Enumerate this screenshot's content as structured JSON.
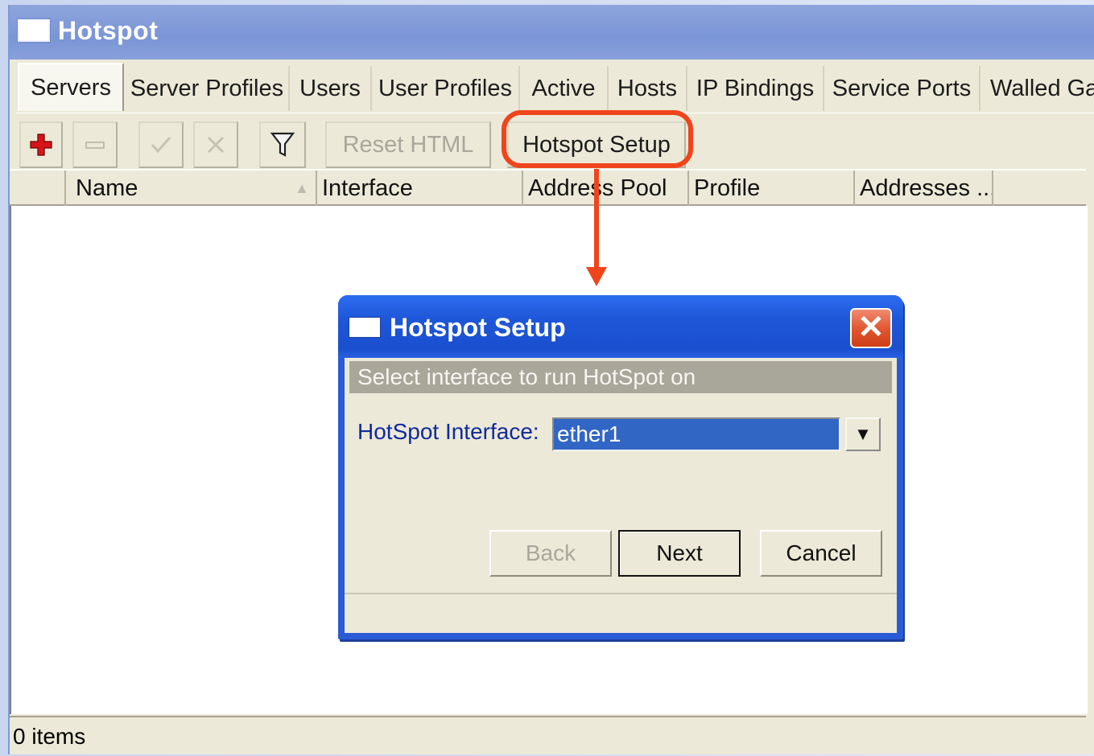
{
  "window": {
    "title": "Hotspot"
  },
  "tabs": [
    {
      "label": "Servers",
      "active": true
    },
    {
      "label": "Server Profiles"
    },
    {
      "label": "Users"
    },
    {
      "label": "User Profiles"
    },
    {
      "label": "Active"
    },
    {
      "label": "Hosts"
    },
    {
      "label": "IP Bindings"
    },
    {
      "label": "Service Ports"
    },
    {
      "label": "Walled Gar"
    }
  ],
  "toolbar": {
    "add_icon": "plus-icon",
    "remove_icon": "minus-icon",
    "enable_icon": "check-icon",
    "disable_icon": "cross-icon",
    "filter_icon": "filter-icon",
    "reset_html_label": "Reset HTML",
    "hotspot_setup_label": "Hotspot Setup"
  },
  "table": {
    "columns": [
      "Name",
      "Interface",
      "Address Pool",
      "Profile",
      "Addresses ..."
    ],
    "sort_indicator": "▲",
    "rows": []
  },
  "status": {
    "items_label": "0 items"
  },
  "dialog": {
    "title": "Hotspot Setup",
    "close_glyph": "✕",
    "banner": "Select interface to run HotSpot on",
    "field_label": "HotSpot Interface:",
    "field_value": "ether1",
    "dropdown_glyph": "▼",
    "back_label": "Back",
    "next_label": "Next",
    "cancel_label": "Cancel"
  },
  "colors": {
    "highlight": "#f0451b",
    "dialog_title": "#1e56d8",
    "selection": "#3166c5"
  }
}
